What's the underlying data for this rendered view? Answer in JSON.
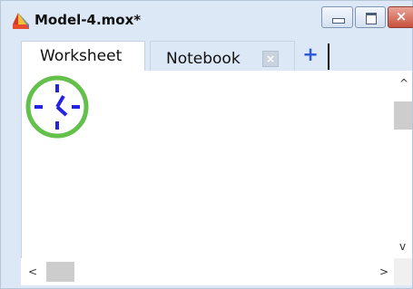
{
  "window": {
    "title": "Model-4.mox*",
    "close_label": "×"
  },
  "tabs": [
    {
      "label": "Worksheet"
    },
    {
      "label": "Notebook",
      "close_label": "×"
    }
  ],
  "add_tab_label": "+",
  "canvas": {
    "clock_icon_color": "#2323e6",
    "clock_ring_color": "#63c04b"
  },
  "scrollbars": {
    "up_arrow": "^",
    "down_arrow": "v",
    "left_arrow": "<",
    "right_arrow": ">"
  }
}
